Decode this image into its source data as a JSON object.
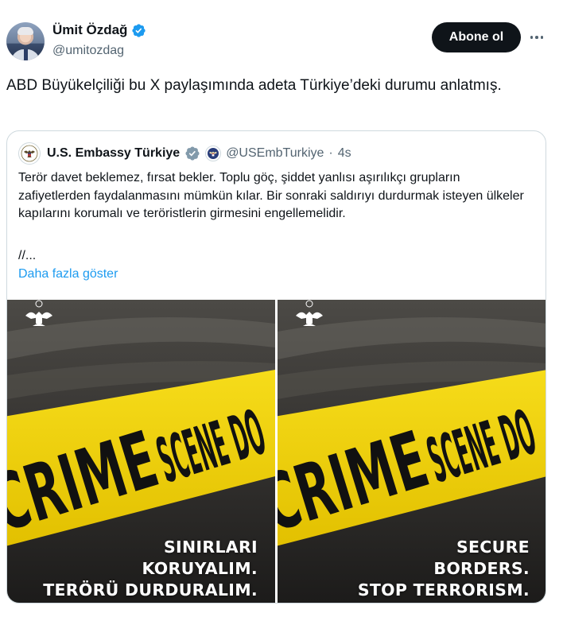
{
  "author": {
    "name": "Ümit Özdağ",
    "handle": "@umitozdag",
    "avatar_icon": "profile-photo",
    "verified_color": "#1d9bf0"
  },
  "actions": {
    "follow_label": "Abone ol",
    "more_icon": "ellipsis-icon"
  },
  "tweet": {
    "text": "ABD Büyükelçiliği bu X paylaşımında adeta Türkiye’deki durumu anlatmış."
  },
  "quoted": {
    "name": "U.S. Embassy Türkiye",
    "handle": "@USEmbTurkiye",
    "separator": "·",
    "time": "4s",
    "body": "Terör davet beklemez, fırsat bekler. Toplu göç, şiddet yanlısı aşırılıkçı grupların zafiyetlerden faydalanmasını mümkün kılar. Bir sonraki saldırıyı durdurmak isteyen ülkeler kapılarını korumalı ve teröristlerin girmesini engellemelidir.",
    "ellipsis": "//...",
    "show_more": "Daha fazla göster",
    "badge_color": "#829aab",
    "images": [
      {
        "tape_text": "CRIME SCENE DO N",
        "caption": [
          "SINIRLARI",
          "KORUYALIM.",
          "TERÖRÜ DURDURALIM."
        ]
      },
      {
        "tape_text": "CRIME SCENE DO N",
        "caption": [
          "SECURE",
          "BORDERS.",
          "STOP TERRORISM."
        ]
      }
    ]
  },
  "colors": {
    "text": "#0f1419",
    "secondary": "#536471",
    "link": "#1d9bf0",
    "tape_yellow": "#f2d40c"
  }
}
